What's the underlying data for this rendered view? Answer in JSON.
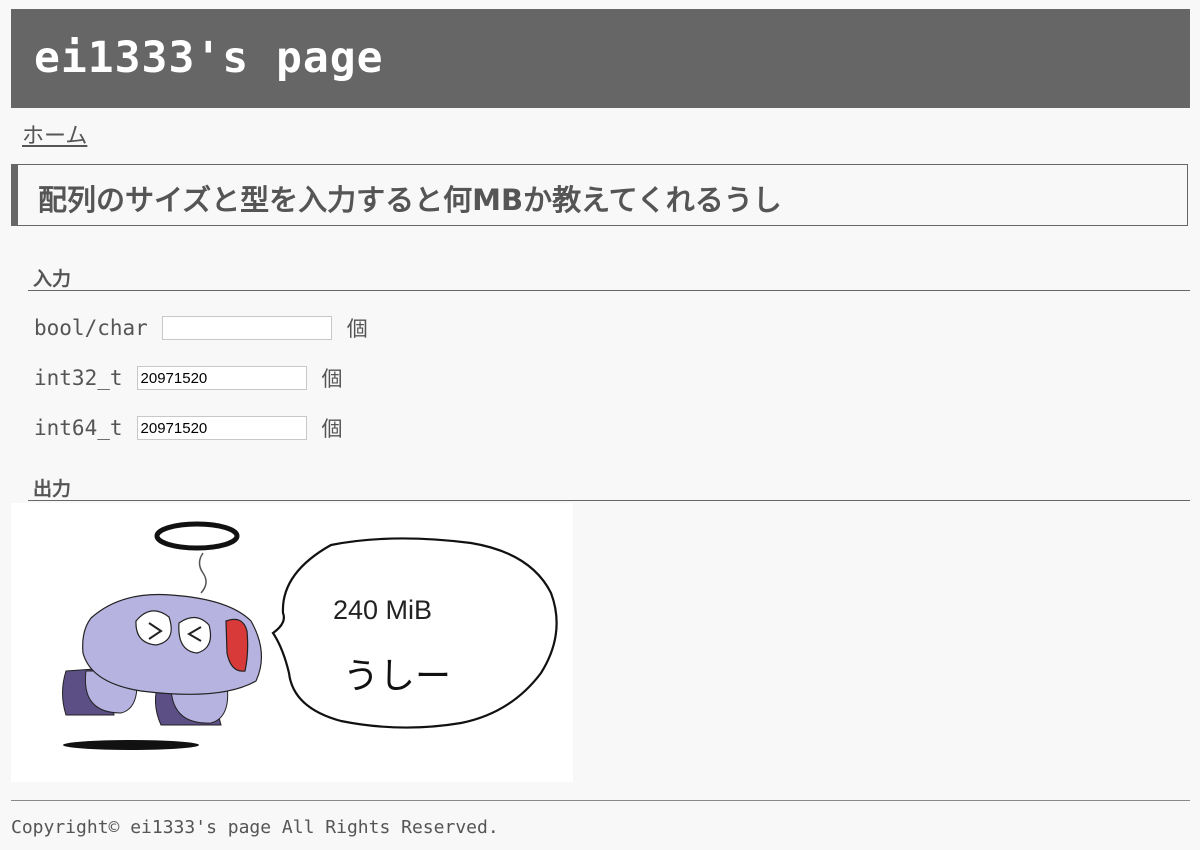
{
  "site": {
    "title": "ei1333's page"
  },
  "nav": {
    "home_label": "ホーム"
  },
  "article": {
    "title": "配列のサイズと型を入力すると何MBか教えてくれるうし"
  },
  "input_section": {
    "label": "入力",
    "rows": [
      {
        "label": "bool/char",
        "value": "",
        "unit": "個"
      },
      {
        "label": "int32_t",
        "value": "20971520",
        "unit": "個"
      },
      {
        "label": "int64_t",
        "value": "20971520",
        "unit": "個"
      }
    ]
  },
  "output_section": {
    "label": "出力",
    "bubble_size": "240 MiB",
    "bubble_cry": "うしー"
  },
  "footer": {
    "copyright": "Copyright© ei1333's page All Rights Reserved."
  },
  "colors": {
    "header_bg": "#666666",
    "page_bg": "#f8f8f8",
    "text": "#555555",
    "ushi_body": "#b7b3e0",
    "ushi_legs": "#5c4f86",
    "ushi_tongue": "#d83a3a"
  }
}
